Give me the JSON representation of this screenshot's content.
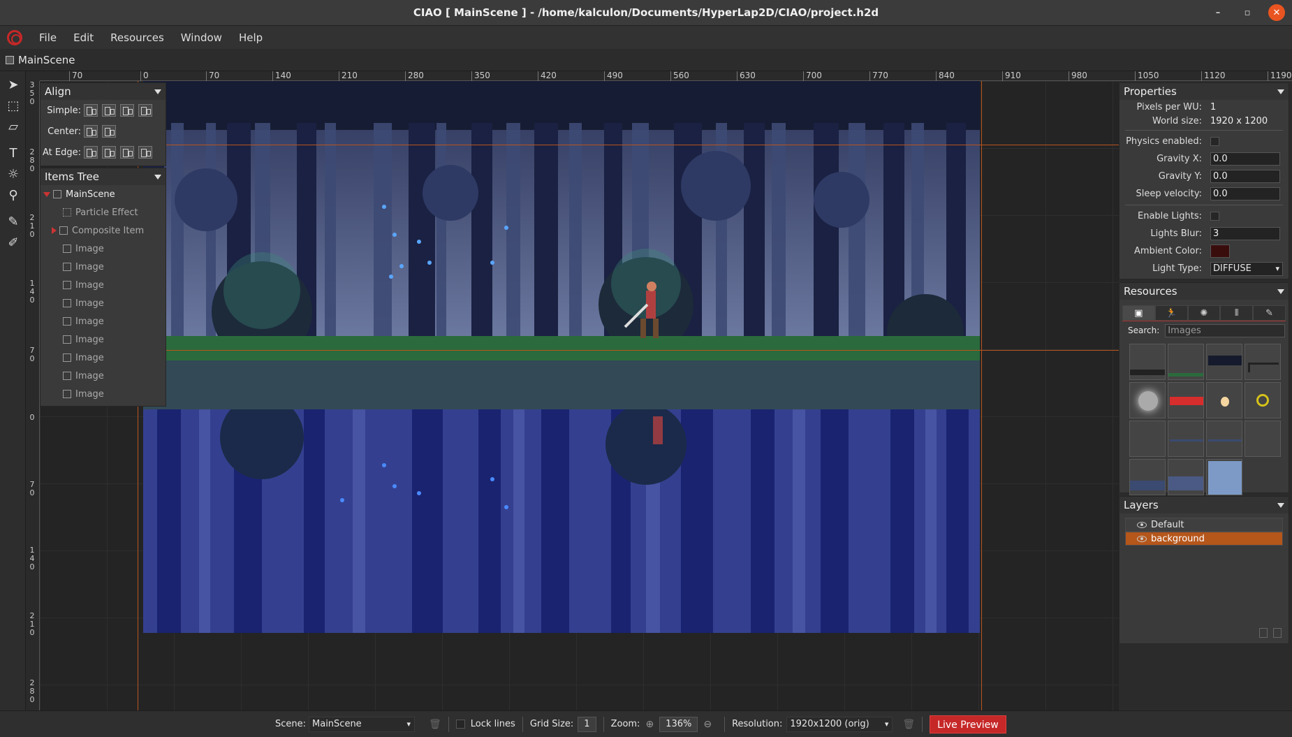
{
  "window": {
    "title": "CIAO [ MainScene ] - /home/kalculon/Documents/HyperLap2D/CIAO/project.h2d",
    "minimize": "–",
    "restore": "▫",
    "close": "✕"
  },
  "menu": {
    "items": [
      "File",
      "Edit",
      "Resources",
      "Window",
      "Help"
    ]
  },
  "scene_tab": {
    "label": "MainScene"
  },
  "ruler": {
    "top_ticks": [
      "70",
      "0",
      "70",
      "140",
      "210",
      "280",
      "350",
      "420",
      "490",
      "560",
      "630",
      "700",
      "770",
      "840",
      "910",
      "980",
      "1050",
      "1120",
      "1190"
    ],
    "left_ticks": [
      "3\n5\n0",
      "2\n8\n0",
      "2\n1\n0",
      "1\n4\n0",
      "7\n0",
      "0",
      "7\n0",
      "1\n4\n0",
      "2\n1\n0",
      "2\n8\n0"
    ]
  },
  "align_panel": {
    "title": "Align",
    "rows": [
      {
        "label": "Simple:",
        "buttons": 4
      },
      {
        "label": "Center:",
        "buttons": 2
      },
      {
        "label": "At Edge:",
        "buttons": 4
      }
    ]
  },
  "items_tree": {
    "title": "Items Tree",
    "root": "MainScene",
    "items": [
      "Particle Effect",
      "Composite Item",
      "Image",
      "Image",
      "Image",
      "Image",
      "Image",
      "Image",
      "Image",
      "Image",
      "Image"
    ]
  },
  "properties": {
    "title": "Properties",
    "pixels_per_wu_label": "Pixels per WU:",
    "pixels_per_wu": "1",
    "world_size_label": "World size:",
    "world_size": "1920 x 1200",
    "physics_label": "Physics enabled:",
    "gravity_x_label": "Gravity X:",
    "gravity_x": "0.0",
    "gravity_y_label": "Gravity Y:",
    "gravity_y": "0.0",
    "sleep_label": "Sleep velocity:",
    "sleep_velocity": "0.0",
    "lights_label": "Enable Lights:",
    "blur_label": "Lights Blur:",
    "lights_blur": "3",
    "ambient_label": "Ambient Color:",
    "light_type_label": "Light Type:",
    "light_type": "DIFFUSE"
  },
  "resources": {
    "title": "Resources",
    "search_label": "Search:",
    "search_value": "Images"
  },
  "layers": {
    "title": "Layers",
    "items": [
      {
        "name": "Default",
        "selected": false
      },
      {
        "name": "background",
        "selected": true
      }
    ]
  },
  "statusbar": {
    "scene_label": "Scene:",
    "scene_value": "MainScene",
    "lock_lines": "Lock lines",
    "grid_label": "Grid Size:",
    "grid_value": "1",
    "zoom_label": "Zoom:",
    "zoom_value": "136%",
    "resolution_label": "Resolution:",
    "resolution_value": "1920x1200 (orig)",
    "live_preview": "Live Preview"
  },
  "colors": {
    "accent": "#b5561b",
    "live_preview": "#c62828",
    "scene_top": "#3e4a7a",
    "scene_bottom": "#2c3580"
  }
}
